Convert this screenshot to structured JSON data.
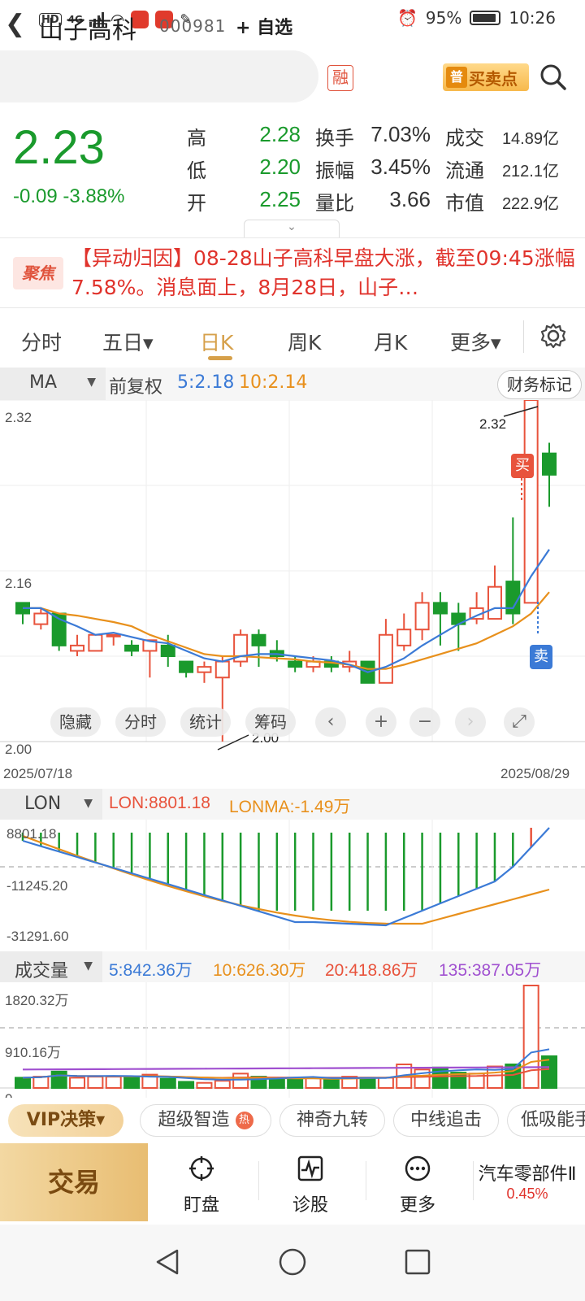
{
  "status_bar": {
    "hd": "HD",
    "net": "4G",
    "battery": "95%",
    "time": "10:26"
  },
  "header": {
    "back_icon": "chevron-left-icon",
    "stock_name": "山子高科",
    "stock_code": "000981",
    "add_favorite": "+ 自选",
    "margin_badge": "融",
    "buy_sell_badge": "普",
    "buy_sell_label": "买卖点"
  },
  "quote": {
    "price": "2.23",
    "change": "-0.09",
    "change_pct": "-3.88%",
    "rows": [
      {
        "k1": "高",
        "v1": "2.28",
        "k2": "换手",
        "v2": "7.03%",
        "k3": "成交",
        "v3": "14.89亿"
      },
      {
        "k1": "低",
        "v1": "2.20",
        "k2": "振幅",
        "v2": "3.45%",
        "k3": "流通",
        "v3": "212.1亿"
      },
      {
        "k1": "开",
        "v1": "2.25",
        "k2": "量比",
        "v2": "3.66",
        "k3": "市值",
        "v3": "222.9亿"
      }
    ]
  },
  "news": {
    "badge": "聚焦",
    "text": "【异动归因】08-28山子高科早盘大涨，截至09:45涨幅7.58%。消息面上，8月28日，山子…"
  },
  "tabs": [
    {
      "label": "分时"
    },
    {
      "label": "五日▾"
    },
    {
      "label": "日K"
    },
    {
      "label": "周K"
    },
    {
      "label": "月K"
    },
    {
      "label": "更多▾"
    }
  ],
  "ma_row": {
    "selector": "MA",
    "adjust": "前复权",
    "ma5": "5:2.18",
    "ma10": "10:2.14",
    "financial_marks": "财务标记"
  },
  "kline": {
    "y_top": "2.32",
    "y_mid": "2.16",
    "y_bottom": "2.00",
    "high_label": "2.32",
    "low_label": "2.00",
    "buy_marker": "买",
    "sell_marker": "卖",
    "date_start": "2025/07/18",
    "date_end": "2025/08/29"
  },
  "chart_tools": [
    "隐藏",
    "分时",
    "统计",
    "筹码"
  ],
  "lon": {
    "selector": "LON",
    "lon_value": "LON:8801.18",
    "lonma_value": "LONMA:-1.49万",
    "y_top": "8801.18",
    "y_mid": "-11245.20",
    "y_bottom": "-31291.60"
  },
  "volume": {
    "selector": "成交量",
    "v5": "5:842.36万",
    "v10": "10:626.30万",
    "v20": "20:418.86万",
    "v135": "135:387.05万",
    "y_top": "1820.32万",
    "y_mid": "910.16万",
    "y_bottom": "0"
  },
  "features": {
    "vip": "VIP决策▾",
    "chips": [
      "超级智造",
      "神奇九转",
      "中线追击",
      "低吸能手"
    ],
    "hot": "热"
  },
  "bottom_nav": {
    "trade": "交易",
    "items": [
      {
        "label": "盯盘",
        "icon": "crosshair-icon"
      },
      {
        "label": "诊股",
        "icon": "pulse-icon"
      },
      {
        "label": "更多",
        "icon": "more-icon"
      }
    ],
    "sector_name": "汽车零部件Ⅱ",
    "sector_pct": "0.45%"
  },
  "colors": {
    "up": "#e8533c",
    "down": "#1a9a2c",
    "ma5": "#3b7ad6",
    "ma10": "#e8901c",
    "ma135": "#a050d0",
    "accent": "#d6a04a"
  },
  "chart_data": [
    {
      "type": "candlestick",
      "title": "",
      "x_range": [
        "2025/07/18",
        "2025/08/29"
      ],
      "ylim": [
        2.0,
        2.32
      ],
      "candles": [
        {
          "o": 2.13,
          "c": 2.12,
          "h": 2.13,
          "l": 2.11
        },
        {
          "o": 2.11,
          "c": 2.12,
          "h": 2.125,
          "l": 2.105
        },
        {
          "o": 2.12,
          "c": 2.09,
          "h": 2.12,
          "l": 2.085
        },
        {
          "o": 2.085,
          "c": 2.09,
          "h": 2.1,
          "l": 2.08
        },
        {
          "o": 2.085,
          "c": 2.1,
          "h": 2.1,
          "l": 2.085
        },
        {
          "o": 2.1,
          "c": 2.1,
          "h": 2.1,
          "l": 2.09
        },
        {
          "o": 2.09,
          "c": 2.085,
          "h": 2.095,
          "l": 2.08
        },
        {
          "o": 2.085,
          "c": 2.095,
          "h": 2.095,
          "l": 2.06
        },
        {
          "o": 2.09,
          "c": 2.08,
          "h": 2.1,
          "l": 2.07
        },
        {
          "o": 2.075,
          "c": 2.065,
          "h": 2.075,
          "l": 2.06
        },
        {
          "o": 2.065,
          "c": 2.07,
          "h": 2.075,
          "l": 2.055
        },
        {
          "o": 2.06,
          "c": 2.075,
          "h": 2.08,
          "l": 2.0
        },
        {
          "o": 2.075,
          "c": 2.1,
          "h": 2.105,
          "l": 2.07
        },
        {
          "o": 2.1,
          "c": 2.09,
          "h": 2.105,
          "l": 2.07
        },
        {
          "o": 2.085,
          "c": 2.08,
          "h": 2.095,
          "l": 2.075
        },
        {
          "o": 2.075,
          "c": 2.07,
          "h": 2.08,
          "l": 2.065
        },
        {
          "o": 2.07,
          "c": 2.075,
          "h": 2.08,
          "l": 2.065
        },
        {
          "o": 2.075,
          "c": 2.07,
          "h": 2.08,
          "l": 2.065
        },
        {
          "o": 2.07,
          "c": 2.075,
          "h": 2.085,
          "l": 2.065
        },
        {
          "o": 2.075,
          "c": 2.055,
          "h": 2.075,
          "l": 2.055
        },
        {
          "o": 2.055,
          "c": 2.1,
          "h": 2.115,
          "l": 2.055
        },
        {
          "o": 2.09,
          "c": 2.105,
          "h": 2.12,
          "l": 2.085
        },
        {
          "o": 2.105,
          "c": 2.13,
          "h": 2.14,
          "l": 2.095
        },
        {
          "o": 2.13,
          "c": 2.12,
          "h": 2.14,
          "l": 2.09
        },
        {
          "o": 2.12,
          "c": 2.11,
          "h": 2.13,
          "l": 2.085
        },
        {
          "o": 2.115,
          "c": 2.125,
          "h": 2.14,
          "l": 2.11
        },
        {
          "o": 2.115,
          "c": 2.145,
          "h": 2.165,
          "l": 2.115
        },
        {
          "o": 2.15,
          "c": 2.12,
          "h": 2.21,
          "l": 2.11
        },
        {
          "o": 2.13,
          "c": 2.32,
          "h": 2.32,
          "l": 2.13
        },
        {
          "o": 2.27,
          "c": 2.25,
          "h": 2.28,
          "l": 2.22
        }
      ],
      "series": [
        {
          "name": "MA5",
          "values": [
            2.125,
            2.125,
            2.115,
            2.108,
            2.1,
            2.102,
            2.098,
            2.094,
            2.092,
            2.085,
            2.078,
            2.075,
            2.08,
            2.082,
            2.082,
            2.08,
            2.078,
            2.076,
            2.072,
            2.065,
            2.07,
            2.078,
            2.09,
            2.1,
            2.11,
            2.118,
            2.125,
            2.125,
            2.155,
            2.18
          ]
        },
        {
          "name": "MA10",
          "values": [
            2.125,
            2.125,
            2.12,
            2.118,
            2.115,
            2.112,
            2.108,
            2.1,
            2.094,
            2.088,
            2.082,
            2.08,
            2.08,
            2.079,
            2.078,
            2.077,
            2.075,
            2.074,
            2.072,
            2.068,
            2.068,
            2.072,
            2.077,
            2.082,
            2.087,
            2.092,
            2.1,
            2.108,
            2.12,
            2.14
          ]
        }
      ]
    },
    {
      "type": "bar",
      "title": "",
      "series": [
        {
          "name": "LON",
          "values": [
            8801.18
          ]
        },
        {
          "name": "LONMA",
          "values": [
            -14900
          ]
        }
      ],
      "ylim": [
        -31291.6,
        8801.18
      ]
    },
    {
      "type": "bar",
      "title": "",
      "ylim": [
        0,
        1820.32
      ],
      "series": [
        {
          "name": "5",
          "values": [
            842.36
          ]
        },
        {
          "name": "10",
          "values": [
            626.3
          ]
        },
        {
          "name": "20",
          "values": [
            418.86
          ]
        },
        {
          "name": "135",
          "values": [
            387.05
          ]
        }
      ]
    }
  ]
}
